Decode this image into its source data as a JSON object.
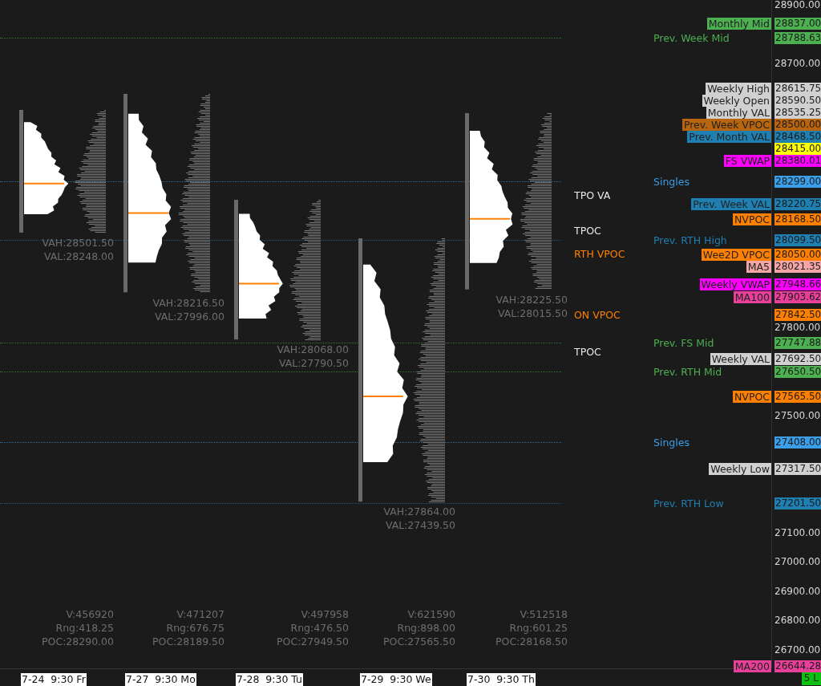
{
  "price_ticks": [
    "28900.00",
    "28700.00",
    "27800.00",
    "27500.00",
    "27100.00",
    "27000.00",
    "26900.00",
    "26800.00",
    "26700.00"
  ],
  "axis_labels": [
    {
      "value": "28837.00",
      "color": "#4caf50",
      "tag": "Monthly Mid"
    },
    {
      "value": "28788.63",
      "color": "#4caf50",
      "line_label": "Prev. Week Mid"
    },
    {
      "value": "28615.75",
      "color": "#d0d0d0",
      "tag": "Weekly High"
    },
    {
      "value": "28590.50",
      "color": "#d0d0d0",
      "tag": "Weekly Open"
    },
    {
      "value": "28535.25",
      "color": "#d0d0d0",
      "tag": "Monthly VAL"
    },
    {
      "value": "28500.00",
      "color": "#b8650d",
      "tag": "Prev. Week VPOC"
    },
    {
      "value": "28468.50",
      "color": "#1f7fb0",
      "tag": "Prev. Month VAL"
    },
    {
      "value": "28415.00",
      "color": "#ffff00"
    },
    {
      "value": "28380.01",
      "color": "#ff00ff",
      "tag": "FS VWAP"
    },
    {
      "value": "28299.00",
      "color": "#3a9ee8",
      "line_label": "Singles"
    },
    {
      "value": "28220.75",
      "color": "#1f7fb0",
      "tag": "Prev. Week VAL"
    },
    {
      "value": "28168.50",
      "color": "#ff8000",
      "tag": "NVPOC"
    },
    {
      "value": "28099.50",
      "color": "#1f7fb0",
      "line_label": "Prev. RTH High"
    },
    {
      "value": "28050.00",
      "color": "#ff8000",
      "tag": "Wee2D VPOC"
    },
    {
      "value": "28021.35",
      "color": "#f4a6a6",
      "tag": "MA5"
    },
    {
      "value": "27948.66",
      "color": "#ff00ff",
      "tag": "Weekly VWAP"
    },
    {
      "value": "27903.62",
      "color": "#e8409a",
      "tag": "MA100"
    },
    {
      "value": "27842.50",
      "color": "#ff8000"
    },
    {
      "value": "27747.88",
      "color": "#4caf50",
      "line_label": "Prev. FS Mid"
    },
    {
      "value": "27692.50",
      "color": "#d0d0d0",
      "tag": "Weekly VAL"
    },
    {
      "value": "27650.50",
      "color": "#4caf50",
      "line_label": "Prev. RTH Mid"
    },
    {
      "value": "27565.50",
      "color": "#ff8000",
      "tag": "NVPOC"
    },
    {
      "value": "27408.00",
      "color": "#3a9ee8",
      "line_label": "Singles"
    },
    {
      "value": "27317.50",
      "color": "#d0d0d0",
      "tag": "Weekly Low"
    },
    {
      "value": "27201.50",
      "color": "#1f7fb0",
      "line_label": "Prev. RTH Low"
    },
    {
      "value": "26644.28",
      "color": "#e8409a",
      "tag": "MA200"
    }
  ],
  "sessions": [
    {
      "date": "7-24  9:30 Fr",
      "vah": "VAH:28501.50",
      "val": "VAL:28248.00",
      "volume": "V:456920",
      "range": "Rng:418.25",
      "poc": "POC:28290.00"
    },
    {
      "date": "7-27  9:30 Mo",
      "vah": "VAH:28216.50",
      "val": "VAL:27996.00",
      "volume": "V:471207",
      "range": "Rng:676.75",
      "poc": "POC:28189.50"
    },
    {
      "date": "7-28  9:30 Tu",
      "vah": "VAH:28068.00",
      "val": "VAL:27790.50",
      "volume": "V:497958",
      "range": "Rng:476.50",
      "poc": "POC:27949.50"
    },
    {
      "date": "7-29  9:30 We",
      "vah": "VAH:27864.00",
      "val": "VAL:27439.50",
      "volume": "V:621590",
      "range": "Rng:898.00",
      "poc": "POC:27565.50"
    },
    {
      "date": "7-30  9:30 Th",
      "vah": "VAH:28225.50",
      "val": "VAL:28015.50",
      "volume": "V:512518",
      "range": "Rng:601.25",
      "poc": "POC:28168.50"
    }
  ],
  "markers": [
    {
      "text": "TPO VA",
      "kind": "tpo"
    },
    {
      "text": "TPOC",
      "kind": "tpo"
    },
    {
      "text": "RTH VPOC",
      "kind": "vpoc"
    },
    {
      "text": "ON VPOC",
      "kind": "vpoc"
    },
    {
      "text": "TPOC",
      "kind": "tpo"
    }
  ],
  "status_badge": "5 L"
}
